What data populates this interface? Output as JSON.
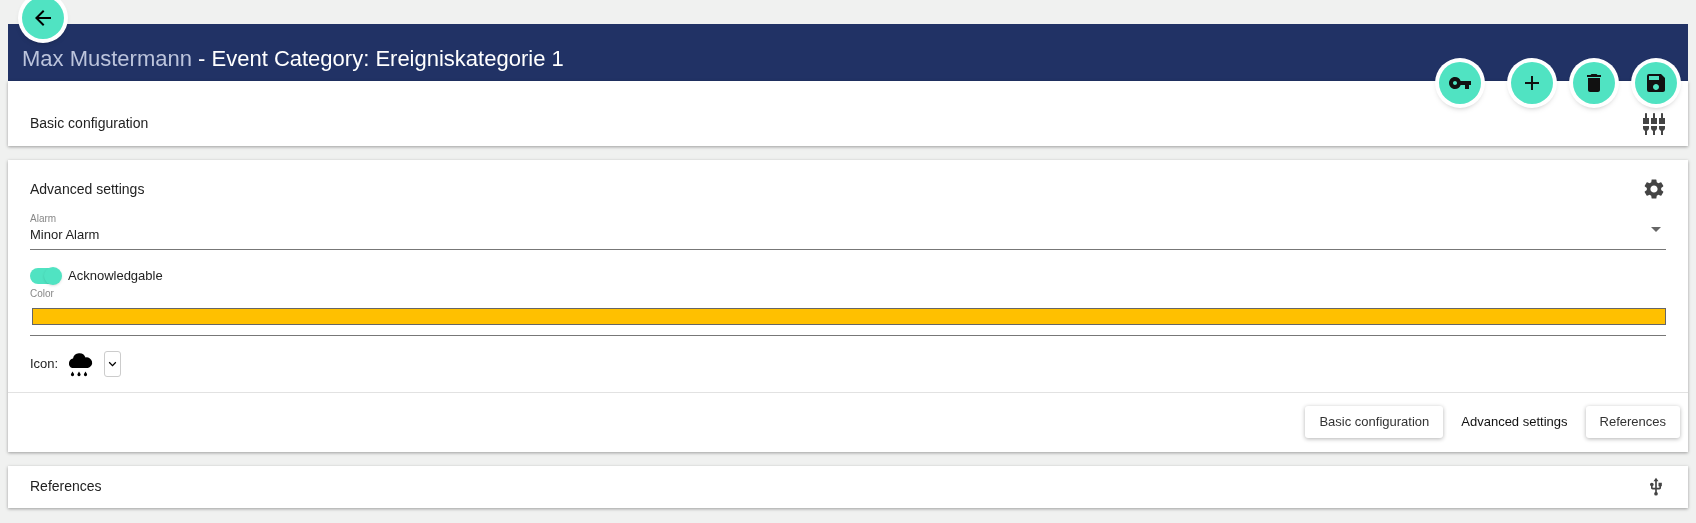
{
  "header": {
    "user": "Max Mustermann",
    "separator": " - ",
    "title": "Event Category: Ereigniskategorie 1"
  },
  "sections": [
    {
      "kind": "collapsed",
      "title": "Basic configuration"
    },
    {
      "kind": "advanced",
      "title": "Advanced settings"
    },
    {
      "kind": "collapsed",
      "title": "References"
    }
  ],
  "advanced": {
    "alarm": {
      "label": "Alarm",
      "value": "Minor Alarm"
    },
    "acknowledgable": {
      "label": "Acknowledgable",
      "on": true
    },
    "color": {
      "label": "Color",
      "color": "#ffc000"
    },
    "icon": {
      "label": "Icon:"
    }
  },
  "nav_buttons": [
    {
      "label": "Basic configuration",
      "selected": false
    },
    {
      "label": "Advanced settings",
      "selected": true
    },
    {
      "label": "References",
      "selected": false
    }
  ]
}
